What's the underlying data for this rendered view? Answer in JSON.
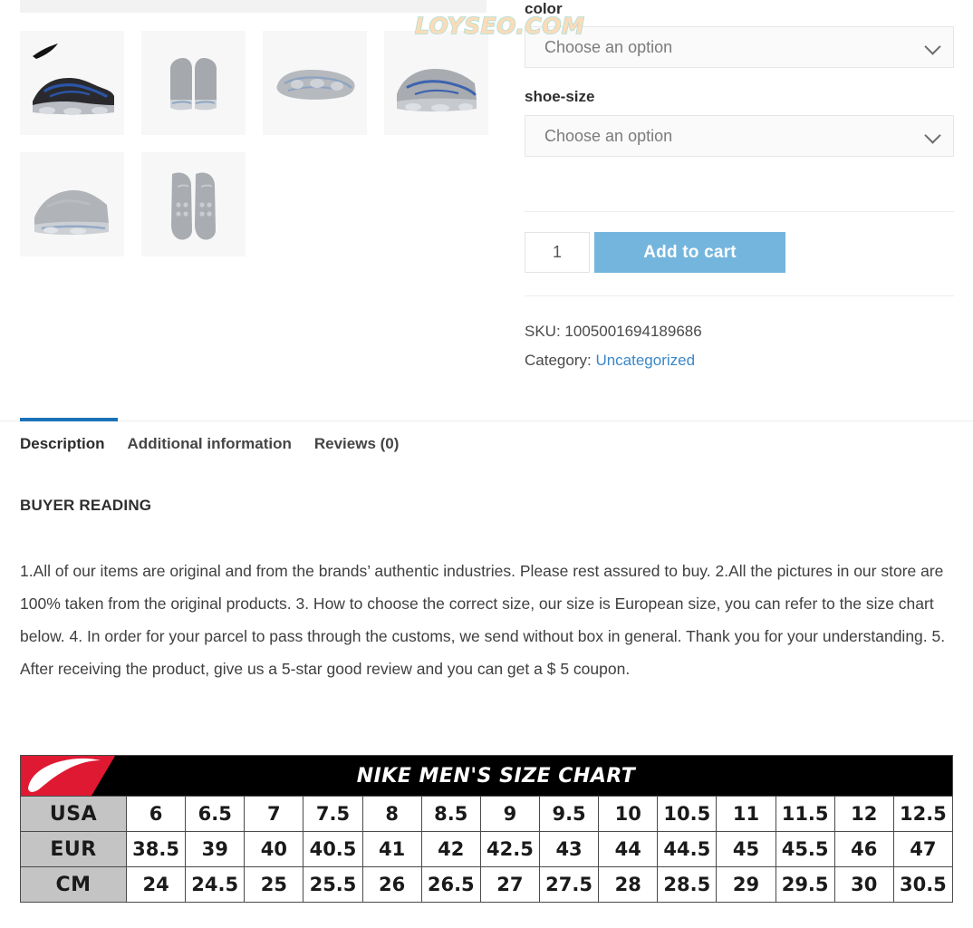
{
  "watermark": {
    "text": "LOYSEO.COM"
  },
  "gallery": {
    "thumbs": [
      {
        "name": "thumbnail-side-view-black-blue",
        "alt": "Nike Air VaporMax side view black blue"
      },
      {
        "name": "thumbnail-back-view",
        "alt": "Nike Air VaporMax back view pair"
      },
      {
        "name": "thumbnail-sole-view",
        "alt": "Nike Air VaporMax outsole view"
      },
      {
        "name": "thumbnail-angled-view",
        "alt": "Nike Air VaporMax angled side view"
      },
      {
        "name": "thumbnail-three-quarter-view",
        "alt": "Nike Air VaporMax three quarter view"
      },
      {
        "name": "thumbnail-top-view",
        "alt": "Nike Air VaporMax top down view pair"
      }
    ]
  },
  "options": {
    "color": {
      "label": "color",
      "value": "Choose an option"
    },
    "shoe_size": {
      "label": "shoe-size",
      "value": "Choose an option"
    }
  },
  "cart": {
    "quantity": "1",
    "add_to_cart_label": "Add to cart"
  },
  "meta": {
    "sku_label": "SKU:",
    "sku_value": "1005001694189686",
    "category_label": "Category:",
    "category_value": "Uncategorized"
  },
  "tabs": [
    {
      "label": "Description",
      "active": true
    },
    {
      "label": "Additional information",
      "active": false
    },
    {
      "label": "Reviews (0)",
      "active": false
    }
  ],
  "description": {
    "heading": "BUYER READING",
    "body": "1.All of our items are original and from the brands’ authentic industries. Please rest assured to buy. 2.All the pictures in our store are 100% taken from the original products. 3. How to choose the correct size, our size is European size, you can refer to the size chart below. 4. In order for your parcel to pass through the customs, we send without box in general. Thank you for your understanding. 5. After receiving the product, give us a 5-star good review and you can get a $ 5 coupon."
  },
  "size_chart": {
    "title": "NIKE MEN'S SIZE CHART",
    "logo": "nike-swoosh-logo",
    "rows": [
      {
        "header": "USA",
        "values": [
          "6",
          "6.5",
          "7",
          "7.5",
          "8",
          "8.5",
          "9",
          "9.5",
          "10",
          "10.5",
          "11",
          "11.5",
          "12",
          "12.5"
        ]
      },
      {
        "header": "EUR",
        "values": [
          "38.5",
          "39",
          "40",
          "40.5",
          "41",
          "42",
          "42.5",
          "43",
          "44",
          "44.5",
          "45",
          "45.5",
          "46",
          "47"
        ]
      },
      {
        "header": "CM",
        "values": [
          "24",
          "24.5",
          "25",
          "25.5",
          "26",
          "26.5",
          "27",
          "27.5",
          "28",
          "28.5",
          "29",
          "29.5",
          "30",
          "30.5"
        ]
      }
    ]
  },
  "colors": {
    "accent_blue": "#1b72b8",
    "button_blue": "#74b5dd",
    "link_blue": "#3a87c8"
  }
}
